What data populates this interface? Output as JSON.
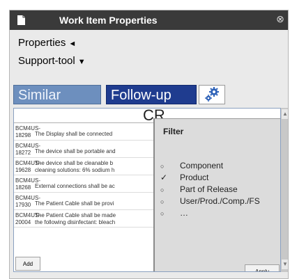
{
  "window": {
    "title": "Work Item Properties",
    "doc_icon": "document-icon",
    "close_glyph": "⊗",
    "titlebar_color": "#3a3a3a"
  },
  "menu": {
    "properties": "Properties",
    "properties_caret": "◄",
    "support_tool": "Support-tool",
    "support_caret": "▼"
  },
  "tabs": {
    "similar": "Similar",
    "follow_up": "Follow-up",
    "gear_icon": "gear-icon",
    "similar_color": "#6d8fbe",
    "follow_up_color": "#1f3c8f"
  },
  "list": {
    "header": "CR",
    "rows": [
      {
        "id": "BCM4US-18298",
        "text": "The Display shall be connected"
      },
      {
        "id": "BCM4US-18272",
        "text": "The device shall be portable and"
      },
      {
        "id": "BCM4US-19628",
        "text": "The device shall be cleanable b",
        "text2": "cleaning solutions: 6% sodium h"
      },
      {
        "id": "BCM4US-18268",
        "text": "External connections shall be ac"
      },
      {
        "id": "BCM4US-17930",
        "text": "The Patient Cable shall be provi"
      },
      {
        "id": "BCM4US-20004",
        "text": "The Patient Cable shall be made",
        "text2": "the following disinfectant: bleach"
      }
    ],
    "add_label": "Add"
  },
  "filter": {
    "title": "Filter",
    "options": [
      {
        "mark": "○",
        "label": "Component"
      },
      {
        "mark": "✓",
        "label": "Product"
      },
      {
        "mark": "○",
        "label": "Part of Release"
      },
      {
        "mark": "○",
        "label": "User/Prod./Comp./FS"
      },
      {
        "mark": "○",
        "label": "…"
      }
    ],
    "apply_label": "Apply"
  }
}
